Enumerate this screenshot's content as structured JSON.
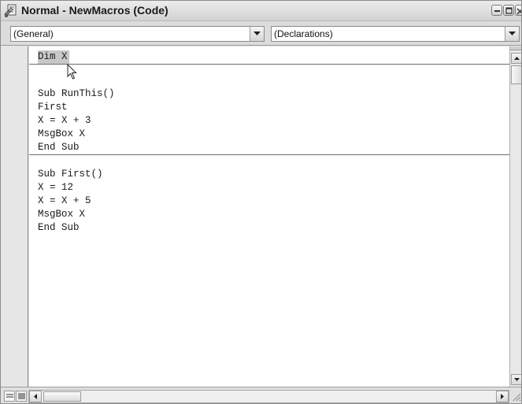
{
  "window": {
    "title": "Normal - NewMacros (Code)",
    "icon": "vba-module-icon"
  },
  "title_buttons": [
    "minimize-icon",
    "maximize-icon",
    "close-icon"
  ],
  "object_combo": {
    "selected": "(General)"
  },
  "procedure_combo": {
    "selected": "(Declarations)"
  },
  "code": {
    "declarations": [
      "Dim X"
    ],
    "procedures": [
      {
        "lines": [
          "Sub RunThis()",
          "First",
          "X = X + 3",
          "MsgBox X",
          "End Sub"
        ]
      },
      {
        "lines": [
          "Sub First()",
          "X = 12",
          "X = X + 5",
          "MsgBox X",
          "End Sub"
        ]
      }
    ]
  },
  "colors": {
    "selection": "#c8c8c8",
    "separator": "#6e6e6e",
    "code_text": "#1a1a1a"
  },
  "icons": {
    "mouse_cursor": "arrow-cursor-icon",
    "procedure_view": "procedure-view-icon",
    "full_module_view": "full-module-view-icon",
    "size_grip": "size-grip-icon"
  }
}
